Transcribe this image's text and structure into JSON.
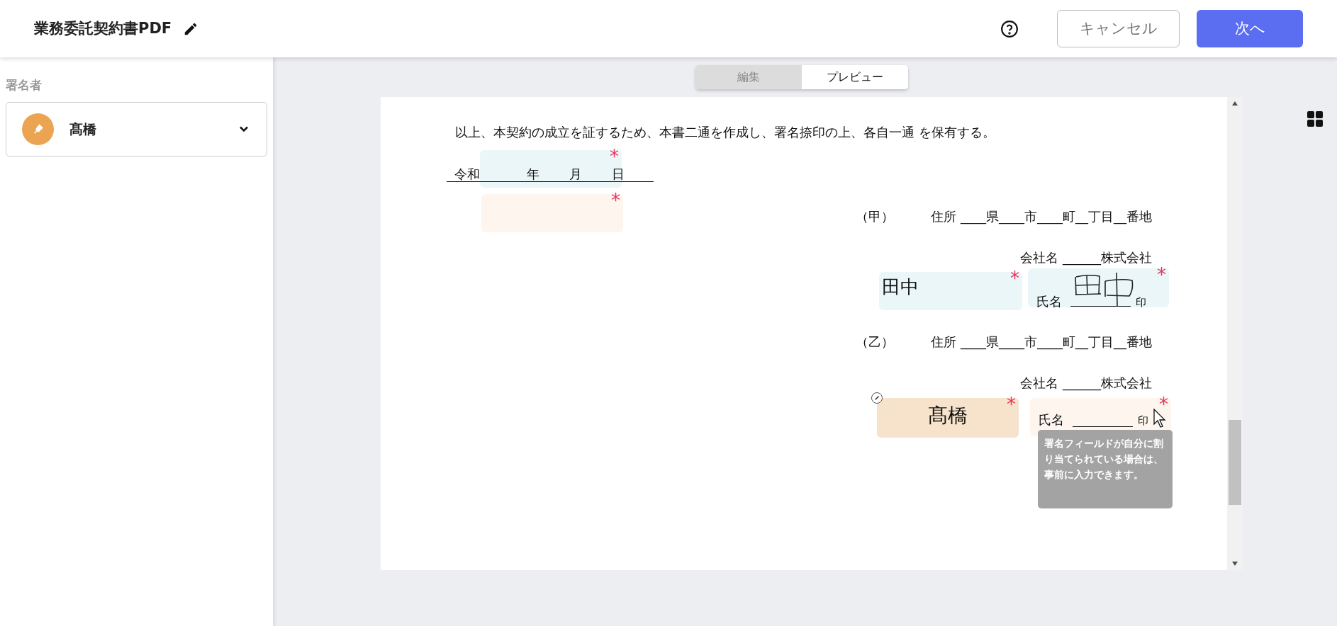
{
  "header": {
    "title": "業務委託契約書PDF",
    "buttons": [
      {
        "label": "キャンセル",
        "kind": "secondary"
      },
      {
        "label": "次へ",
        "kind": "primary"
      }
    ]
  },
  "sidebar": {
    "heading": "署名者",
    "signer": {
      "name": "髙橋",
      "color": "#eba452"
    }
  },
  "view_tabs": [
    {
      "label": "編集",
      "selected": false
    },
    {
      "label": "プレビュー",
      "selected": true
    }
  ],
  "page": {
    "sentence": "以上、本契約の成立を証するため、本書二通を作成し、署名捺印の上、各自一通 を保有する。",
    "date_line": {
      "era": "令和",
      "year": "年",
      "month": "月",
      "day": "日"
    },
    "parties": [
      {
        "label": "（甲）",
        "address": "住所 ____県____市____町__丁目__番地",
        "company": "会社名 ______株式会社",
        "name_label": "氏名",
        "seal": "印"
      },
      {
        "label": "（乙）",
        "address": "住所 ____県____市____町__丁目__番地",
        "company": "会社名 ______株式会社",
        "name_label": "氏名",
        "seal": "印"
      }
    ],
    "fields": [
      {
        "kind": "date",
        "color": "#ebf6f9",
        "required_mark": "*",
        "selected": false
      },
      {
        "kind": "blank",
        "color": "#fdf5ee",
        "required_mark": "*",
        "selected": false
      },
      {
        "kind": "text",
        "value": "田中",
        "color": "#ebf6f9",
        "required_mark": "*",
        "selected": false
      },
      {
        "kind": "signature",
        "signed": true,
        "color": "#ebf6f9",
        "required_mark": "*",
        "selected": false
      },
      {
        "kind": "text",
        "value": "髙橋",
        "color": "#f7e3cc",
        "required_mark": "*",
        "selected": true
      },
      {
        "kind": "signature",
        "signed": false,
        "color": "#fdf5ee",
        "required_mark": "*",
        "selected": false
      }
    ],
    "tooltip": "署名フィールドが自分に割り当てられている場合は、事前に入力できます。"
  }
}
